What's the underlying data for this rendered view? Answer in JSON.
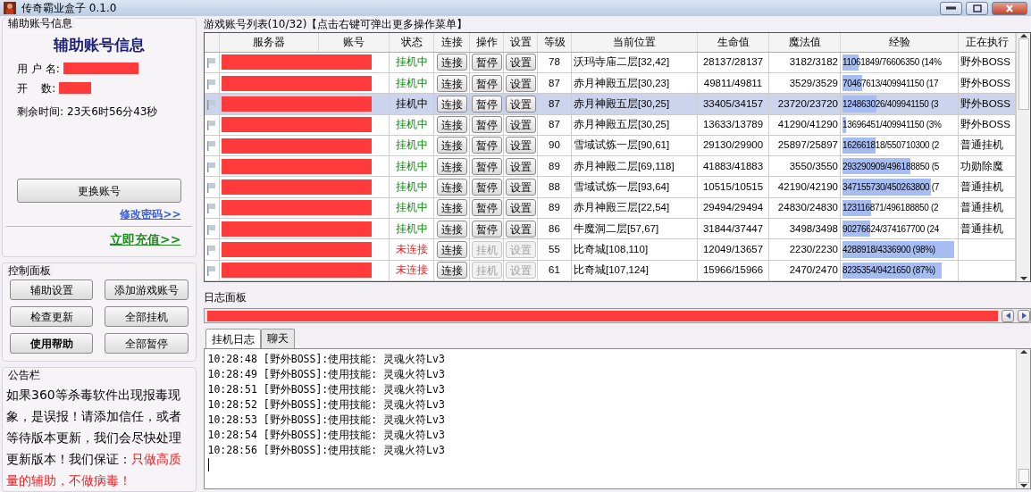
{
  "window": {
    "title": "传奇霸业盒子 0.1.0"
  },
  "account_panel": {
    "group_title": "辅助账号信息",
    "heading": "辅助账号信息",
    "fields": [
      {
        "label": "用 户 名:",
        "redacted": true
      },
      {
        "label": "开    数:",
        "redacted": true
      }
    ],
    "remaining_label": "剩余时间:",
    "remaining": "23天6时56分43秒",
    "switch_button": "更换账号",
    "change_password": "修改密码>>",
    "recharge": "立即充值>>"
  },
  "control_panel": {
    "group_title": "控制面板",
    "buttons": [
      {
        "label": "辅助设置",
        "bold": false
      },
      {
        "label": "添加游戏账号",
        "bold": false
      },
      {
        "label": "检查更新",
        "bold": false
      },
      {
        "label": "全部挂机",
        "bold": false
      },
      {
        "label": "使用帮助",
        "bold": true
      },
      {
        "label": "全部暂停",
        "bold": false
      }
    ]
  },
  "notice": {
    "group_title": "公告栏",
    "text": "如果360等杀毒软件出现报毒现象，是误报！请添加信任，或者等待版本更新，我们会尽快处理更新版本！我们保证：",
    "highlight": "只做高质量的辅助，不做病毒！"
  },
  "accounts": {
    "title": "游戏账号列表(10/32)【点击右键可弹出更多操作菜单】",
    "columns": [
      "服务器",
      "账号",
      "状态",
      "连接",
      "操作",
      "设置",
      "等级",
      "当前位置",
      "生命值",
      "魔法值",
      "经验",
      "正在执行"
    ],
    "rows": [
      {
        "selected": false,
        "redacted": true,
        "status": "挂机中",
        "kind": "online",
        "buttons": [
          {
            "label": "连接",
            "disabled": false
          },
          {
            "label": "暂停",
            "disabled": false
          },
          {
            "label": "设置",
            "disabled": false
          }
        ],
        "grade": "78",
        "location": "沃玛寺庙二层[32,42]",
        "hp": "28137/28137",
        "mp": "3182/3182",
        "exp": "11061849/76606350 (14%",
        "level": 0.14,
        "task": "野外BOSS"
      },
      {
        "selected": false,
        "redacted": true,
        "status": "挂机中",
        "kind": "online",
        "buttons": [
          {
            "label": "连接",
            "disabled": false
          },
          {
            "label": "暂停",
            "disabled": false
          },
          {
            "label": "设置",
            "disabled": false
          }
        ],
        "grade": "87",
        "location": "赤月神殿五层[30,23]",
        "hp": "49811/49811",
        "mp": "3529/3529",
        "exp": "70467613/409941150 (17",
        "level": 0.17,
        "task": "野外BOSS"
      },
      {
        "selected": true,
        "redacted": true,
        "status": "挂机中",
        "kind": "online",
        "buttons": [
          {
            "label": "连接",
            "disabled": false
          },
          {
            "label": "暂停",
            "disabled": false
          },
          {
            "label": "设置",
            "disabled": false
          }
        ],
        "grade": "87",
        "location": "赤月神殿五层[30,25]",
        "hp": "33405/34157",
        "mp": "23720/23720",
        "exp": "124863026/409941150 (3",
        "level": 0.3,
        "task": "野外BOSS"
      },
      {
        "selected": false,
        "redacted": true,
        "status": "挂机中",
        "kind": "online",
        "buttons": [
          {
            "label": "连接",
            "disabled": false
          },
          {
            "label": "暂停",
            "disabled": false
          },
          {
            "label": "设置",
            "disabled": false
          }
        ],
        "grade": "87",
        "location": "赤月神殿五层[30,25]",
        "hp": "13633/13789",
        "mp": "41290/41290",
        "exp": "13696451/409941150 (3%",
        "level": 0.03,
        "task": "野外BOSS"
      },
      {
        "selected": false,
        "redacted": true,
        "status": "挂机中",
        "kind": "online",
        "buttons": [
          {
            "label": "连接",
            "disabled": false
          },
          {
            "label": "暂停",
            "disabled": false
          },
          {
            "label": "设置",
            "disabled": false
          }
        ],
        "grade": "90",
        "location": "雪域试炼一层[90,61]",
        "hp": "29130/29900",
        "mp": "25897/25897",
        "exp": "162661818/550710300 (2",
        "level": 0.29,
        "task": "普通挂机"
      },
      {
        "selected": false,
        "redacted": true,
        "status": "挂机中",
        "kind": "online",
        "buttons": [
          {
            "label": "连接",
            "disabled": false
          },
          {
            "label": "暂停",
            "disabled": false
          },
          {
            "label": "设置",
            "disabled": false
          }
        ],
        "grade": "89",
        "location": "赤月神殿二层[69,118]",
        "hp": "41883/41883",
        "mp": "3550/3550",
        "exp": "293290909/496188850 (5",
        "level": 0.59,
        "task": "功勋除魔"
      },
      {
        "selected": false,
        "redacted": true,
        "status": "挂机中",
        "kind": "online",
        "buttons": [
          {
            "label": "连接",
            "disabled": false
          },
          {
            "label": "暂停",
            "disabled": false
          },
          {
            "label": "设置",
            "disabled": false
          }
        ],
        "grade": "88",
        "location": "雪域试炼一层[93,64]",
        "hp": "10515/10515",
        "mp": "42190/42190",
        "exp": "347155730/450263800 (7",
        "level": 0.77,
        "task": "普通挂机"
      },
      {
        "selected": false,
        "redacted": true,
        "status": "挂机中",
        "kind": "online",
        "buttons": [
          {
            "label": "连接",
            "disabled": false
          },
          {
            "label": "暂停",
            "disabled": false
          },
          {
            "label": "设置",
            "disabled": false
          }
        ],
        "grade": "89",
        "location": "赤月神殿三层[22,54]",
        "hp": "29494/29494",
        "mp": "24830/24830",
        "exp": "123116871/496188850 (2",
        "level": 0.25,
        "task": "普通挂机"
      },
      {
        "selected": false,
        "redacted": true,
        "status": "挂机中",
        "kind": "online",
        "buttons": [
          {
            "label": "连接",
            "disabled": false
          },
          {
            "label": "暂停",
            "disabled": false
          },
          {
            "label": "设置",
            "disabled": false
          }
        ],
        "grade": "86",
        "location": "牛魔洞二层[57,67]",
        "hp": "31844/37447",
        "mp": "3498/3498",
        "exp": "90276624/374167700 (24",
        "level": 0.24,
        "task": "普通挂机"
      },
      {
        "selected": false,
        "redacted": true,
        "status": "未连接",
        "kind": "offline",
        "buttons": [
          {
            "label": "连接",
            "disabled": false
          },
          {
            "label": "挂机",
            "disabled": true
          },
          {
            "label": "设置",
            "disabled": true
          }
        ],
        "grade": "55",
        "location": "比奇城[108,110]",
        "hp": "12049/13657",
        "mp": "2230/2230",
        "exp": "4288918/4336900 (98%)",
        "level": 0.98
      },
      {
        "selected": false,
        "redacted": true,
        "status": "未连接",
        "kind": "offline",
        "buttons": [
          {
            "label": "连接",
            "disabled": false
          },
          {
            "label": "挂机",
            "disabled": true
          },
          {
            "label": "设置",
            "disabled": true
          }
        ],
        "grade": "61",
        "location": "比奇城[107,124]",
        "hp": "15966/15966",
        "mp": "2470/2470",
        "exp": "8235354/9421650 (87%)",
        "level": 0.87
      }
    ]
  },
  "log_panel": {
    "group_title": "日志面板",
    "strip_redacted": true,
    "tabs": [
      {
        "label": "挂机日志",
        "selected": true
      },
      {
        "label": "聊天",
        "selected": false
      }
    ],
    "lines": [
      "10:28:48 [野外BOSS]:使用技能: 灵魂火符Lv3",
      "10:28:49 [野外BOSS]:使用技能: 灵魂火符Lv3",
      "10:28:51 [野外BOSS]:使用技能: 灵魂火符Lv3",
      "10:28:52 [野外BOSS]:使用技能: 灵魂火符Lv3",
      "10:28:53 [野外BOSS]:使用技能: 灵魂火符Lv3",
      "10:28:54 [野外BOSS]:使用技能: 灵魂火符Lv3",
      "10:28:56 [野外BOSS]:使用技能: 灵魂火符Lv3"
    ]
  }
}
